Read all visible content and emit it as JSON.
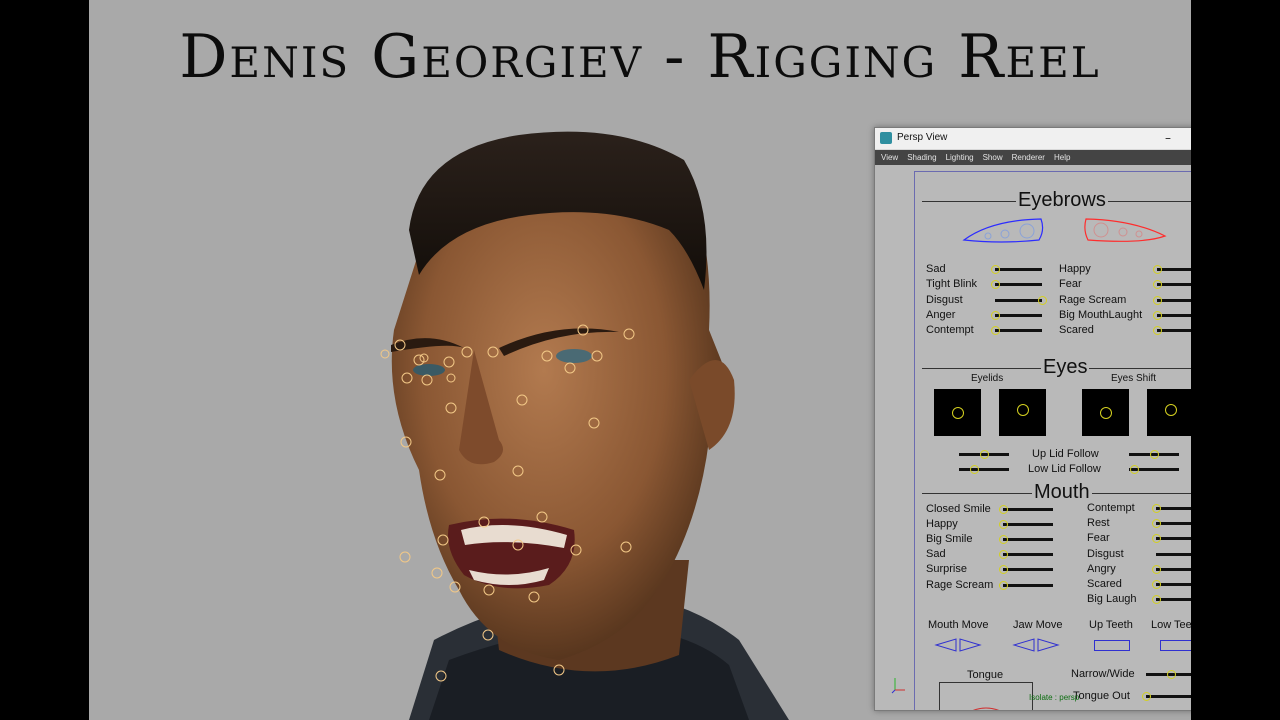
{
  "title": "Denis Georgiev - Rigging Reel",
  "window": {
    "title": "Persp View",
    "controls": {
      "minimize": "–",
      "maximize": "☐",
      "close": "✕"
    },
    "menu": [
      "View",
      "Shading",
      "Lighting",
      "Show",
      "Renderer",
      "Help"
    ],
    "isolate": "Isolate : persp"
  },
  "eyebrows": {
    "heading": "Eyebrows",
    "left": [
      {
        "label": "Sad",
        "value": 0
      },
      {
        "label": "Tight Blink",
        "value": 0
      },
      {
        "label": "Disgust",
        "value": 1
      },
      {
        "label": "Anger",
        "value": 0
      },
      {
        "label": "Contempt",
        "value": 0
      }
    ],
    "right": [
      {
        "label": "Happy",
        "value": 0
      },
      {
        "label": "Fear",
        "value": 0
      },
      {
        "label": "Rage Scream",
        "value": 0
      },
      {
        "label": "Big MouthLaught",
        "value": 0
      },
      {
        "label": "Scared",
        "value": 0
      }
    ]
  },
  "eyes": {
    "heading": "Eyes",
    "eyelids_label": "Eyelids",
    "eyes_shift_label": "Eyes Shift",
    "sliders": [
      {
        "label": "Up Lid Follow",
        "left": 0.5,
        "right": 0.5
      },
      {
        "label": "Low Lid Follow",
        "left": 0.3,
        "right": 0.1
      }
    ]
  },
  "mouth": {
    "heading": "Mouth",
    "left": [
      {
        "label": "Closed Smile",
        "value": 0
      },
      {
        "label": "Happy",
        "value": 0
      },
      {
        "label": "Big Smile",
        "value": 0
      },
      {
        "label": "Sad",
        "value": 0
      },
      {
        "label": "Surprise",
        "value": 0
      },
      {
        "label": "Rage Scream",
        "value": 0
      }
    ],
    "right": [
      {
        "label": "Contempt",
        "value": 0
      },
      {
        "label": "Rest",
        "value": 0
      },
      {
        "label": "Fear",
        "value": 0
      },
      {
        "label": "Disgust",
        "value": 1
      },
      {
        "label": "Angry",
        "value": 0
      },
      {
        "label": "Scared",
        "value": 0
      },
      {
        "label": "Big Laugh",
        "value": 0
      }
    ],
    "controls": [
      "Mouth Move",
      "Jaw Move",
      "Up Teeth",
      "Low Teeth"
    ],
    "tongue": "Tongue",
    "narrow_wide": {
      "label": "Narrow/Wide",
      "value": 0.5
    },
    "tongue_out": {
      "label": "Tongue Out",
      "value": 0
    }
  },
  "colors": {
    "knob": "#d4d020",
    "left_brow": "#2c2cff",
    "right_brow": "#ff2c2c",
    "mouth_ctrl": "#3030d0",
    "window_bar": "#f0f0f0",
    "menu_bar": "#444444"
  }
}
